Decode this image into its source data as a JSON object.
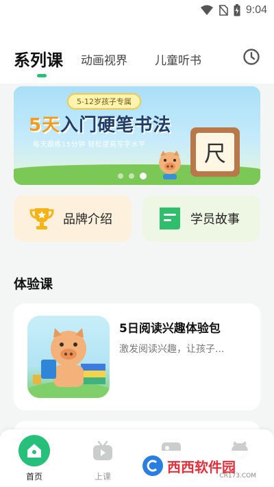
{
  "status_bar": {
    "time": "9:04"
  },
  "tabs": [
    {
      "label": "系列课",
      "active": true
    },
    {
      "label": "动画视界",
      "active": false
    },
    {
      "label": "儿童听书",
      "active": false
    }
  ],
  "banner": {
    "badge": "5-12岁孩子专属",
    "title_highlight": "5天",
    "title_rest": "入门硬笔书法",
    "subtitle": "每天跟练15分钟 轻松提高写字水平",
    "board_char": "尺",
    "slide_count": 3,
    "active_slide": 3
  },
  "quick_cards": [
    {
      "label": "品牌介绍",
      "icon": "trophy-icon"
    },
    {
      "label": "学员故事",
      "icon": "document-icon"
    }
  ],
  "section": {
    "title": "体验课"
  },
  "course": {
    "title": "5日阅读兴趣体验包",
    "description": "激发阅读兴趣，让孩子..."
  },
  "bottom_nav": [
    {
      "label": "首页",
      "icon": "home-icon",
      "active": true
    },
    {
      "label": "上课",
      "icon": "tv-icon",
      "active": false
    },
    {
      "label": "",
      "icon": "image-icon",
      "active": false
    },
    {
      "label": "",
      "icon": "pig-icon",
      "active": false
    }
  ],
  "watermark": {
    "brand": "西西软件园",
    "url": "CR173.COM"
  },
  "colors": {
    "accent": "#26c07a",
    "brand_card": "#fdf0dd",
    "story_card": "#edf7e4",
    "background": "#f4f6f5"
  }
}
